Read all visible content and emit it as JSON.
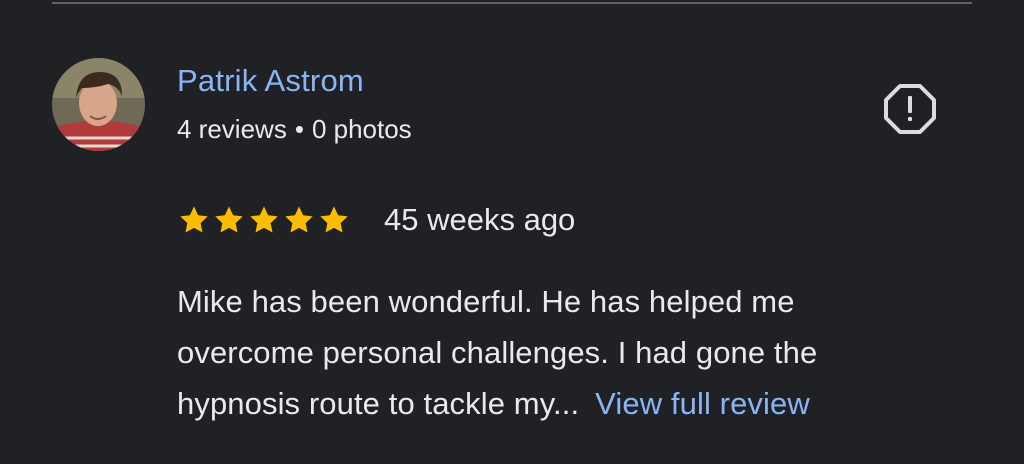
{
  "review": {
    "author": "Patrik Astrom",
    "reviews_count": "4 reviews",
    "separator": "•",
    "photos_count": "0 photos",
    "rating": 5,
    "date": "45 weeks ago",
    "text_lines": [
      "Mike has been wonderful. He has helped me",
      "overcome personal challenges. I had gone the",
      "hypnosis route to tackle my..."
    ],
    "view_full_label": "View full review"
  },
  "icons": {
    "report": "report-flag-icon",
    "star": "star-icon",
    "avatar": "user-avatar"
  },
  "colors": {
    "background": "#202124",
    "link": "#8ab4f8",
    "text": "#e8eaed",
    "star": "#fbbc04",
    "icon": "#dadce0"
  }
}
